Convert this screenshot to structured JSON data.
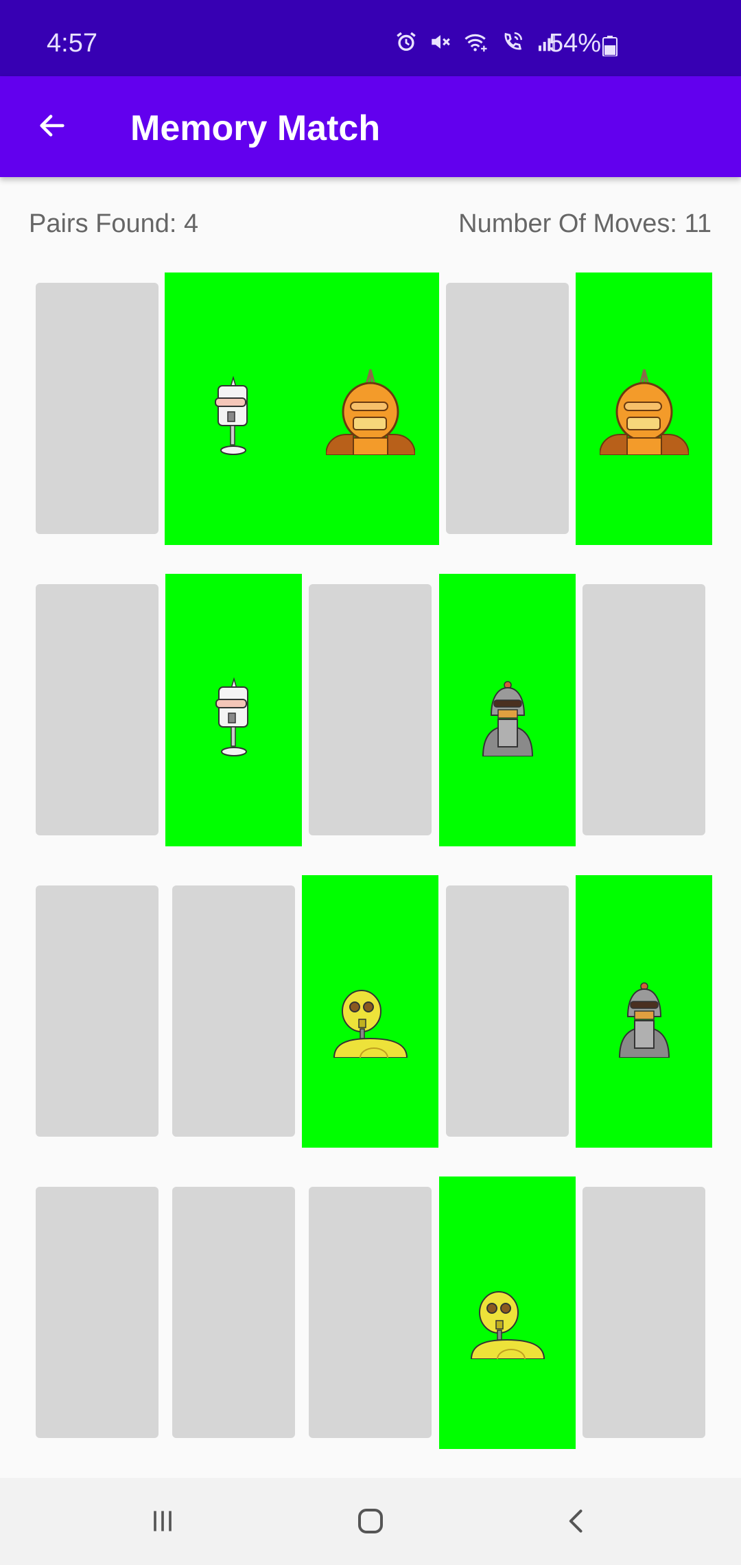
{
  "status_bar": {
    "time": "4:57",
    "battery": "54%",
    "icons": [
      "alarm-icon",
      "mute-icon",
      "wifi-icon",
      "wifi-call-icon",
      "signal-icon",
      "battery-icon"
    ]
  },
  "app_bar": {
    "title": "Memory Match",
    "back_icon": "arrow-back-icon"
  },
  "stats": {
    "pairs_found": "Pairs Found: 4",
    "moves": "Number Of Moves: 11"
  },
  "colors": {
    "status_bar": "#3700b3",
    "app_bar": "#6200ee",
    "card_back": "#d6d6d6",
    "card_revealed": "#00ff00"
  },
  "board": {
    "rows": 4,
    "cols": 5,
    "cards": [
      [
        "hidden",
        "white-robot",
        "orange-robot",
        "hidden",
        "orange-robot"
      ],
      [
        "hidden",
        "white-robot",
        "hidden",
        "gray-robot",
        "hidden"
      ],
      [
        "hidden",
        "hidden",
        "yellow-robot",
        "hidden",
        "gray-robot"
      ],
      [
        "hidden",
        "hidden",
        "hidden",
        "yellow-robot",
        "hidden"
      ]
    ]
  },
  "nav_bar": {
    "buttons": [
      "recent-apps-icon",
      "home-icon",
      "back-icon"
    ]
  }
}
